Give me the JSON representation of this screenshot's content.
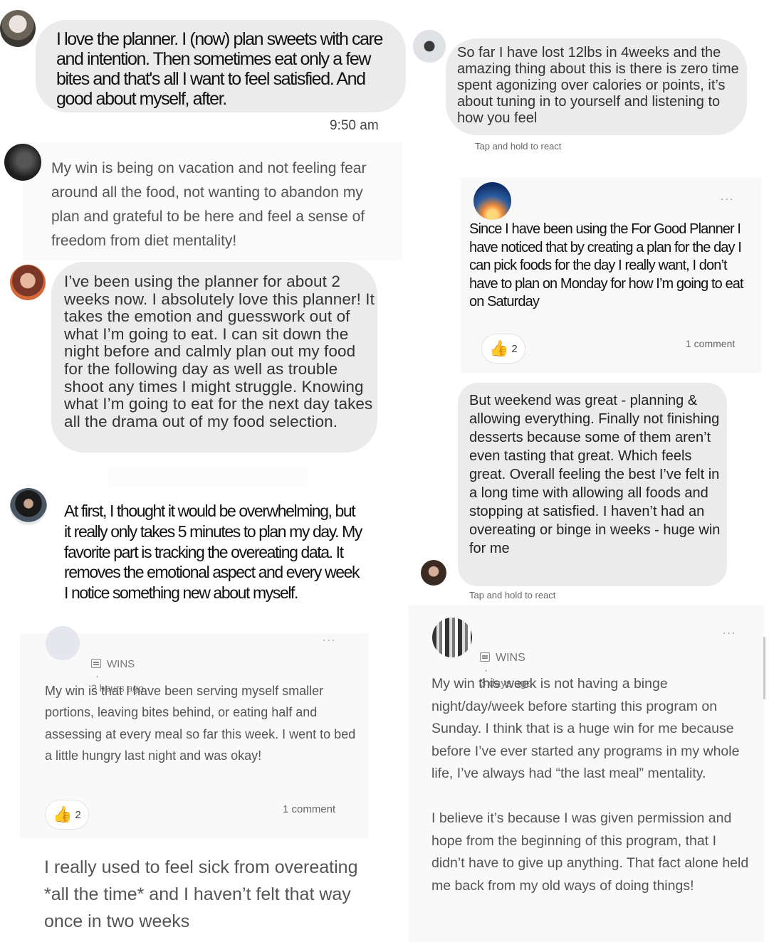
{
  "posts": {
    "p1": {
      "text": "I love the planner. I  (now) plan sweets  with care and intention. Then sometimes eat only a few bites and that's all I want to feel satisfied. And good about myself, after.",
      "time": "9:50 am"
    },
    "p2": {
      "text": "My win is being on vacation and not feeling fear around all the food, not wanting to abandon my plan and grateful to be here and feel a sense of freedom from diet mentality!"
    },
    "p3": {
      "text": "I’ve been using the planner for about 2 weeks now. I absolutely love this planner! It takes the emotion and guesswork out of what I’m going to eat. I can sit down the night before and calmly plan out my food for the following day as well as trouble shoot  any times I might struggle. Knowing what I’m going to eat for the next day takes all the drama out of my food selection."
    },
    "p4": {
      "text": "At first, I thought it would be overwhelming, but it really only takes 5 minutes to plan my day. My favorite part is tracking the overeating data. It removes the emotional aspect and every week I notice something new about myself."
    },
    "p5": {
      "category": "WINS",
      "dot": "·",
      "time": "2 hours ago",
      "text": "My win is that I have been serving myself smaller portions, leaving bites behind, or eating half and assessing at every meal so far this week. I went to bed a little hungry last night and was okay!",
      "reactions": "2",
      "comments": "1 comment",
      "more": "..."
    },
    "p6": {
      "text": "I really used to feel sick from overeating *all the time* and I haven’t felt that way once in two weeks"
    },
    "p7": {
      "text": "So far I have lost 12lbs in 4weeks and the amazing thing about this is there is zero time spent agonizing over calories or points, it’s about tuning in to yourself and listening to how you feel",
      "hint": "Tap and hold to react"
    },
    "p8": {
      "text": "Since I have been using the For Good Planner I have noticed that by creating a plan for the day I can pick foods for the day I really want, I don’t have to plan on Monday for how I’m going to eat on Saturday",
      "reactions": "2",
      "comments": "1 comment",
      "more": "..."
    },
    "p9": {
      "text": "But weekend was great - planning & allowing everything. Finally not finishing desserts because some of them aren’t even tasting that great. Which feels great. Overall feeling the best I’ve felt in a long time with allowing all foods and stopping at satisfied. I haven’t had an overeating or binge in weeks - huge win for me",
      "hint": "Tap and hold to react"
    },
    "p10": {
      "category": "WINS",
      "dot": "·",
      "time": "3 days ago",
      "more": "...",
      "text": "My win this week is not having a binge night/day/week before starting this program on Sunday. I think that is a huge win for me because before I’ve ever started any programs in my whole life, I’ve always had “the last meal” mentality.\n\nI believe it’s because I was given permission and hope from the beginning of this program, that I didn’t have to give up anything. That fact alone held me back from my old ways of doing things!"
    }
  },
  "icons": {
    "like": "thumbs-up-icon",
    "category": "list-icon",
    "more": "more-dots-icon"
  },
  "colors": {
    "bubble": "#ebebeb",
    "card": "#f7f7f7",
    "text": "#222222",
    "meta": "#777777"
  }
}
